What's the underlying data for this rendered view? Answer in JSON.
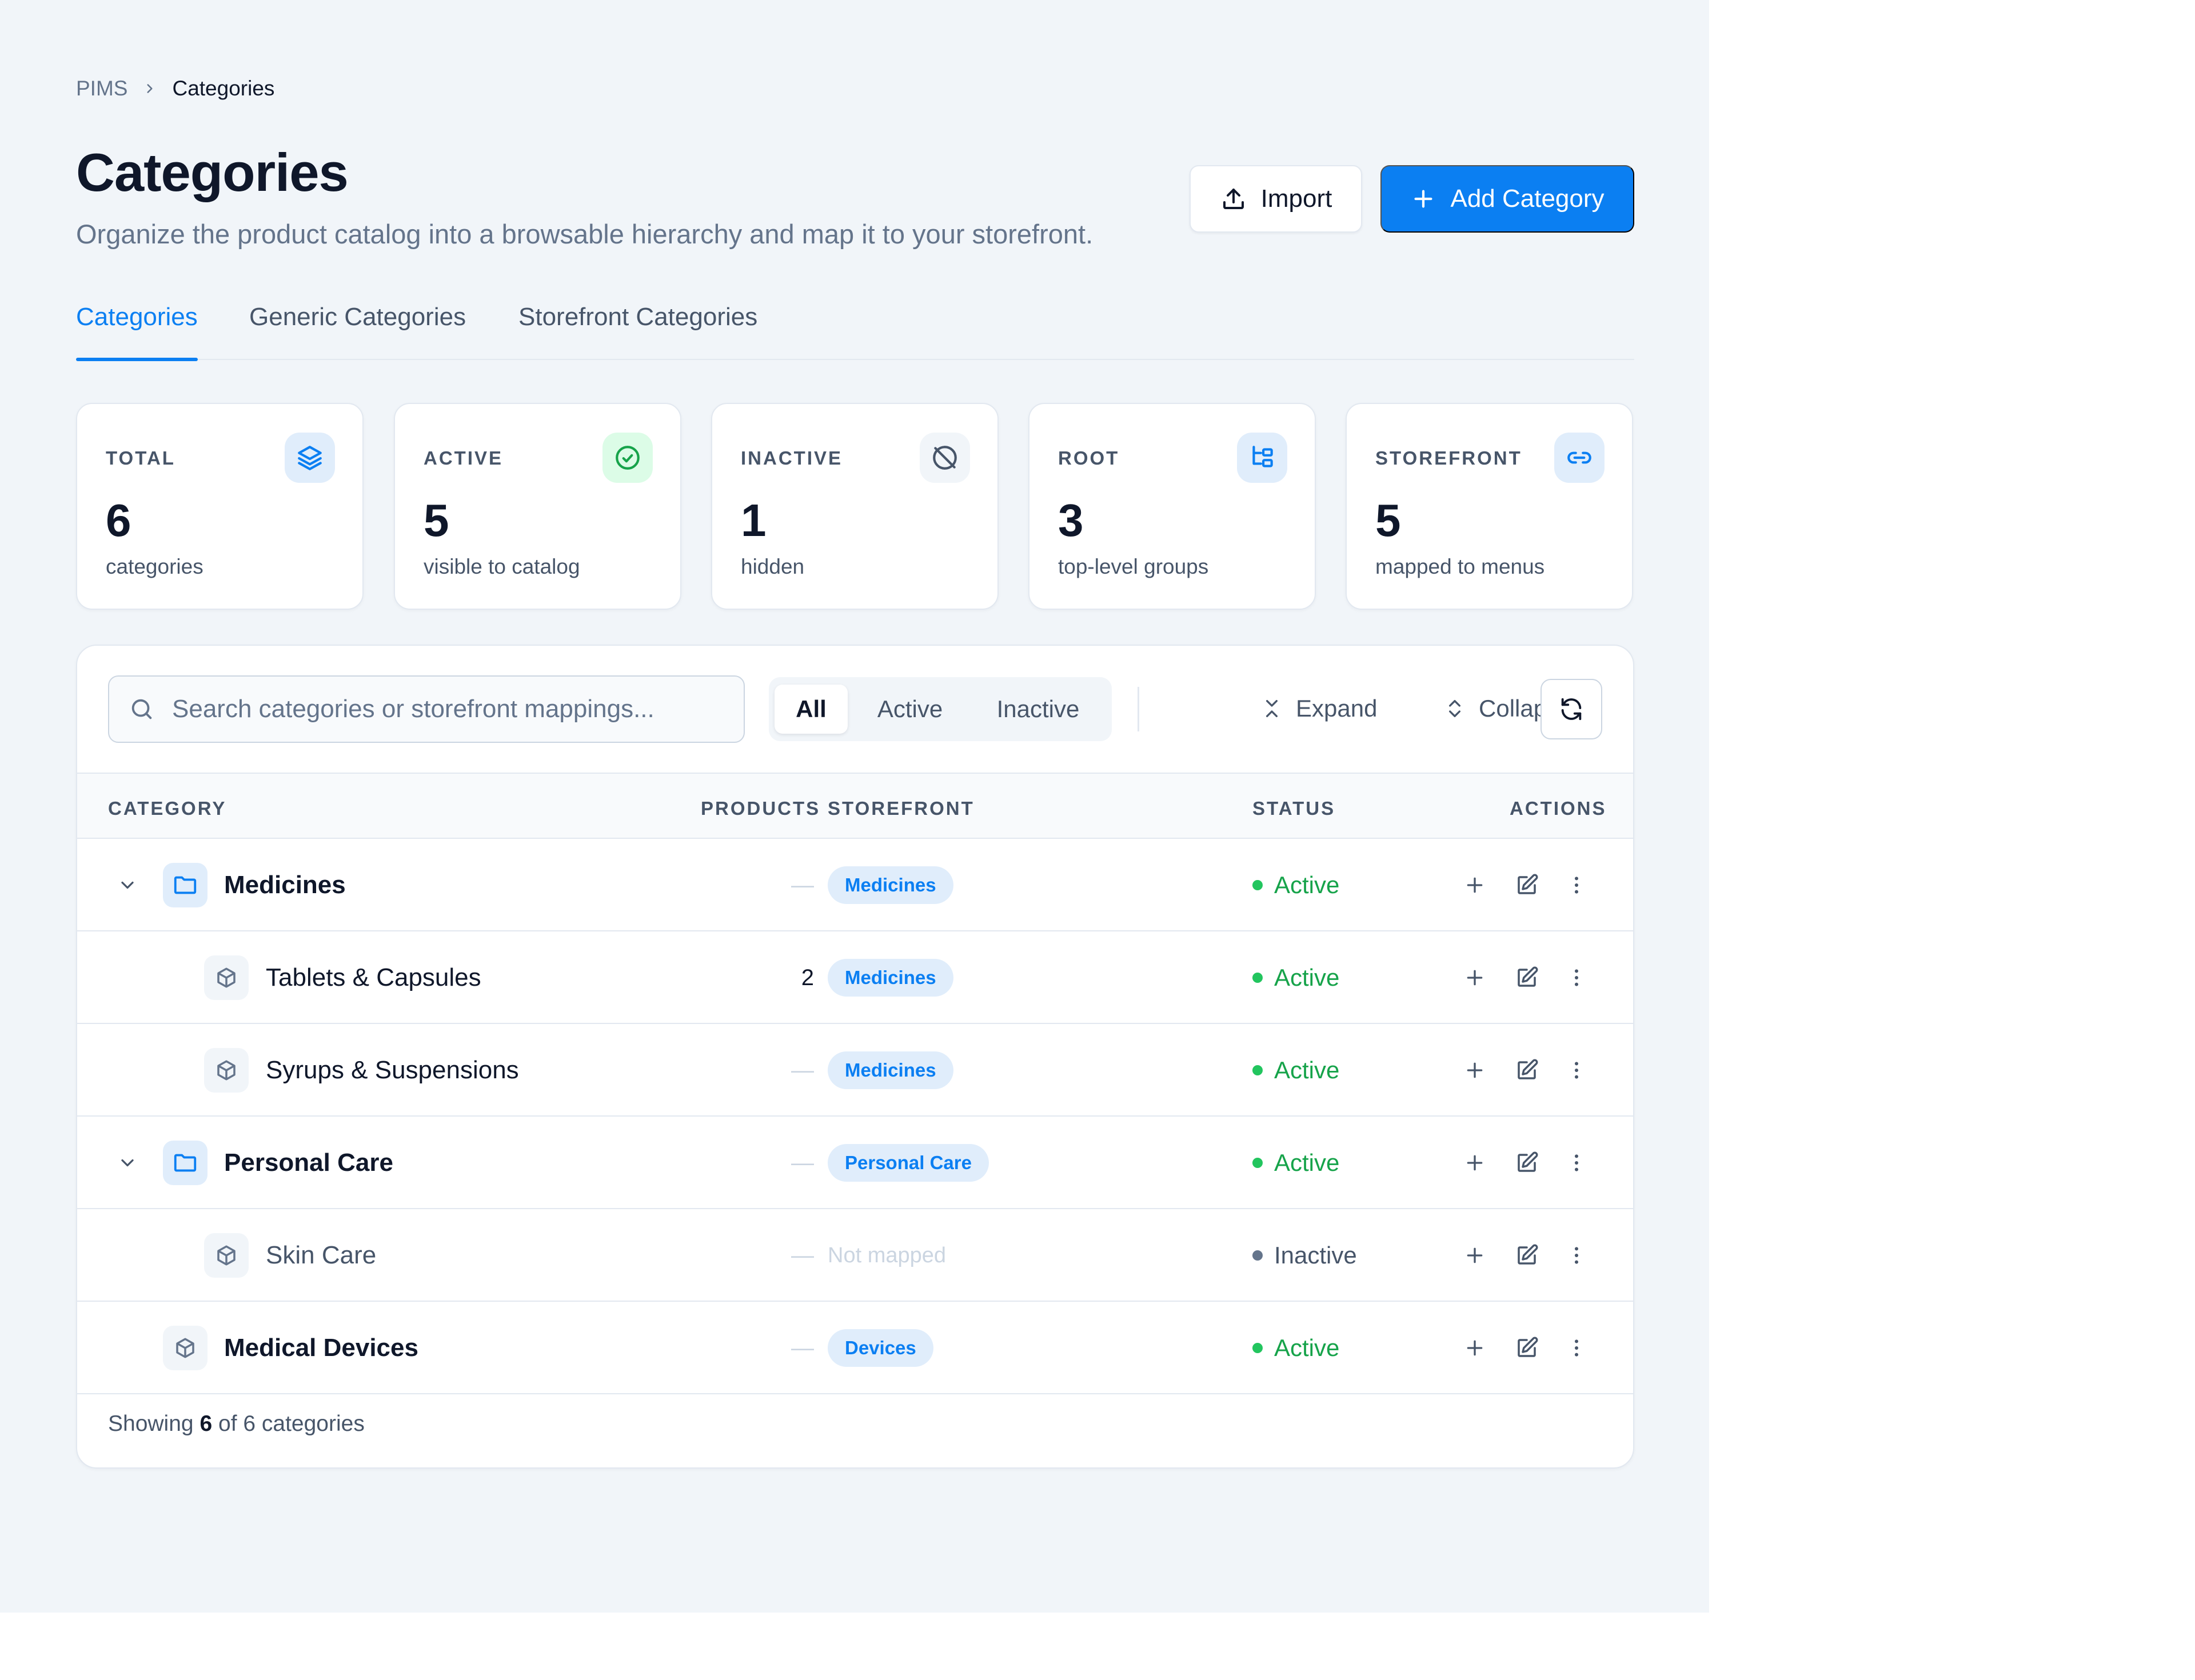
{
  "breadcrumb": {
    "root": "PIMS",
    "current": "Categories"
  },
  "header": {
    "title": "Categories",
    "subtitle": "Organize the product catalog into a browsable hierarchy and map it to your storefront.",
    "import_label": "Import",
    "add_label": "Add Category",
    "accent_color": "#0b7ff2"
  },
  "tabs": [
    {
      "label": "Categories",
      "active": true
    },
    {
      "label": "Generic Categories",
      "active": false
    },
    {
      "label": "Storefront Categories",
      "active": false
    }
  ],
  "stats": [
    {
      "label": "TOTAL",
      "value": "6",
      "caption": "categories",
      "icon": "layers-icon"
    },
    {
      "label": "ACTIVE",
      "value": "5",
      "caption": "visible to catalog",
      "icon": "check-circle-icon"
    },
    {
      "label": "INACTIVE",
      "value": "1",
      "caption": "hidden",
      "icon": "eye-off-icon"
    },
    {
      "label": "ROOT",
      "value": "3",
      "caption": "top-level groups",
      "icon": "tree-icon"
    },
    {
      "label": "STOREFRONT",
      "value": "5",
      "caption": "mapped to menus",
      "icon": "link-icon"
    }
  ],
  "toolbar": {
    "search_placeholder": "Search categories or storefront mappings...",
    "filters": [
      {
        "label": "All",
        "active": true
      },
      {
        "label": "Active",
        "active": false
      },
      {
        "label": "Inactive",
        "active": false
      }
    ],
    "expand_label": "Expand",
    "collapse_label": "Collapse"
  },
  "table": {
    "columns": {
      "category": "CATEGORY",
      "products": "PRODUCTS",
      "storefront": "STOREFRONT",
      "status": "STATUS",
      "actions": "ACTIONS"
    },
    "rows": [
      {
        "name": "Medicines",
        "level": 0,
        "expandable": true,
        "icon": "folder-icon",
        "products": "—",
        "storefront": "Medicines",
        "status": "Active"
      },
      {
        "name": "Tablets & Capsules",
        "level": 1,
        "expandable": false,
        "icon": "box-icon",
        "products": "2",
        "storefront": "Medicines",
        "status": "Active"
      },
      {
        "name": "Syrups & Suspensions",
        "level": 1,
        "expandable": false,
        "icon": "box-icon",
        "products": "—",
        "storefront": "Medicines",
        "status": "Active"
      },
      {
        "name": "Personal Care",
        "level": 0,
        "expandable": true,
        "icon": "folder-icon",
        "products": "—",
        "storefront": "Personal Care",
        "status": "Active"
      },
      {
        "name": "Skin Care",
        "level": 1,
        "expandable": false,
        "icon": "box-icon",
        "products": "—",
        "storefront": "Not mapped",
        "status": "Inactive"
      },
      {
        "name": "Medical Devices",
        "level": 0,
        "expandable": false,
        "icon": "box-icon",
        "products": "—",
        "storefront": "Devices",
        "status": "Active"
      }
    ]
  },
  "footer": {
    "prefix": "Showing",
    "shown": "6",
    "suffix": "of 6 categories"
  }
}
